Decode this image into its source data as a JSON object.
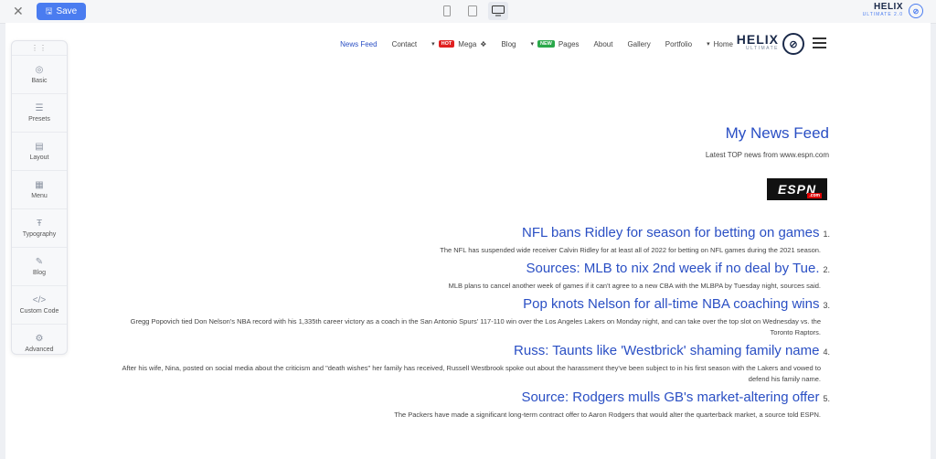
{
  "editor": {
    "save_label": "Save",
    "close_icon": "close-icon",
    "devices": [
      "mobile",
      "tablet",
      "desktop"
    ],
    "active_device": "desktop",
    "brand": {
      "name": "HELIX",
      "sub": "ULTIMATE",
      "version": "2.0"
    }
  },
  "site": {
    "logo": {
      "name": "HELIX",
      "sub": "ULTIMATE"
    },
    "nav": [
      {
        "label": "Home",
        "caret": true
      },
      {
        "label": "Portfolio"
      },
      {
        "label": "Gallery"
      },
      {
        "label": "About"
      },
      {
        "label": "Pages",
        "badge": "NEW",
        "caret": true
      },
      {
        "label": "Blog"
      },
      {
        "label": "Mega",
        "badge": "HOT",
        "caret": true
      },
      {
        "label": "Contact"
      },
      {
        "label": "News Feed",
        "active": true
      }
    ]
  },
  "panel": {
    "items": [
      {
        "label": "Basic",
        "icon": "target-icon"
      },
      {
        "label": "Presets",
        "icon": "sliders-icon"
      },
      {
        "label": "Layout",
        "icon": "layout-icon"
      },
      {
        "label": "Menu",
        "icon": "menu-icon"
      },
      {
        "label": "Typography",
        "icon": "typography-icon"
      },
      {
        "label": "Blog",
        "icon": "blog-icon"
      },
      {
        "label": "Custom Code",
        "icon": "code-icon"
      },
      {
        "label": "Advanced",
        "icon": "gear-icon"
      }
    ]
  },
  "feed": {
    "title": "My News Feed",
    "subtitle": "Latest TOP news from www.espn.com",
    "logo_text": "ESPN",
    "logo_sub": ".com",
    "items": [
      {
        "num": "1.",
        "headline": "NFL bans Ridley for season for betting on games",
        "summary": "The NFL has suspended wide receiver Calvin Ridley for at least all of 2022 for betting on NFL games during the 2021 season."
      },
      {
        "num": "2.",
        "headline": "Sources: MLB to nix 2nd week if no deal by Tue.",
        "summary": "MLB plans to cancel another week of games if it can't agree to a new CBA with the MLBPA by Tuesday night, sources said."
      },
      {
        "num": "3.",
        "headline": "Pop knots Nelson for all-time NBA coaching wins",
        "summary": "Gregg Popovich tied Don Nelson's NBA record with his 1,335th career victory as a coach in the San Antonio Spurs' 117-110 win over the Los Angeles Lakers on Monday night, and can take over the top slot on Wednesday vs. the Toronto Raptors."
      },
      {
        "num": "4.",
        "headline": "Russ: Taunts like 'Westbrick' shaming family name",
        "summary": "After his wife, Nina, posted on social media about the criticism and \"death wishes\" her family has received, Russell Westbrook spoke out about the harassment they've been subject to in his first season with the Lakers and vowed to defend his family name."
      },
      {
        "num": "5.",
        "headline": "Source: Rodgers mulls GB's market-altering offer",
        "summary": "The Packers have made a significant long-term contract offer to Aaron Rodgers that would alter the quarterback market, a source told ESPN."
      }
    ]
  }
}
